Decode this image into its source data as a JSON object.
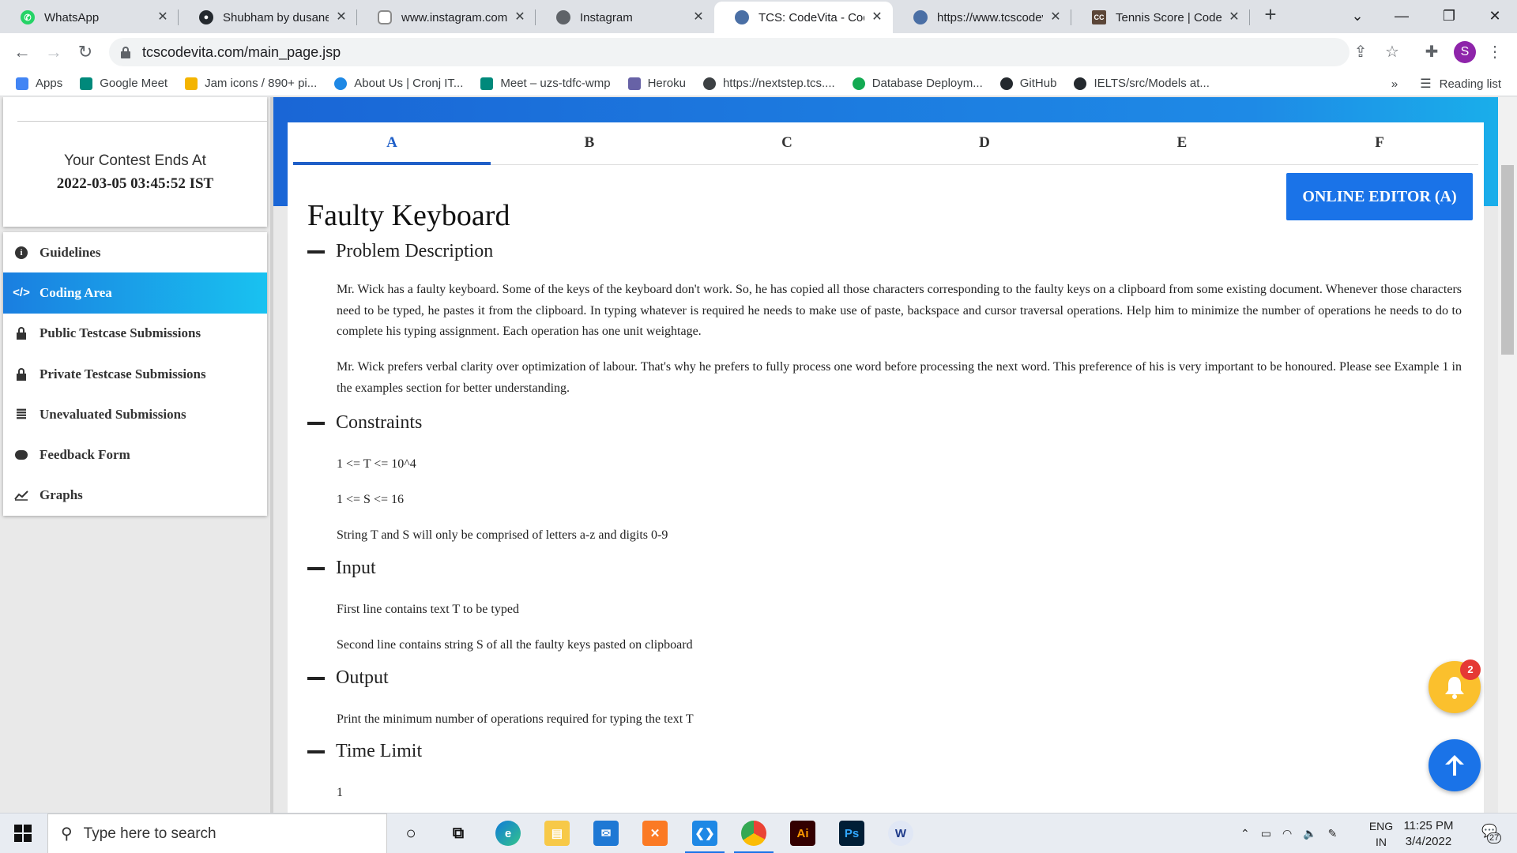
{
  "browser": {
    "tabs": [
      {
        "title": "WhatsApp",
        "icon": "whatsapp-icon",
        "color": "#25d366",
        "active": false
      },
      {
        "title": "Shubham by dusanes",
        "icon": "github-icon",
        "color": "#24292e",
        "active": false
      },
      {
        "title": "www.instagram.com",
        "icon": "instagram-icon",
        "color": "#8a8a8a",
        "active": false
      },
      {
        "title": "Instagram",
        "icon": "globe-icon",
        "color": "#5f6368",
        "active": false
      },
      {
        "title": "TCS: CodeVita - Codin",
        "icon": "tcs-icon",
        "color": "#4a6fa5",
        "active": true
      },
      {
        "title": "https://www.tcscodev",
        "icon": "tcs-icon",
        "color": "#4a6fa5",
        "active": false
      },
      {
        "title": "Tennis Score | CodeCh",
        "icon": "codechef-icon",
        "color": "#5b4638",
        "active": false
      }
    ],
    "url": "tcscodevita.com/main_page.jsp",
    "profile_initial": "S",
    "bookmarks": [
      {
        "label": "Apps",
        "color": "#4285f4"
      },
      {
        "label": "Google Meet",
        "color": "#00897b"
      },
      {
        "label": "Jam icons / 890+ pi...",
        "color": "#f4b400"
      },
      {
        "label": "About Us | Cronj IT...",
        "color": "#1e88e5"
      },
      {
        "label": "Meet – uzs-tdfc-wmp",
        "color": "#00897b"
      },
      {
        "label": "Heroku",
        "color": "#6762a6"
      },
      {
        "label": "https://nextstep.tcs....",
        "color": "#3c4043"
      },
      {
        "label": "Database Deploym...",
        "color": "#13aa52"
      },
      {
        "label": "GitHub",
        "color": "#24292e"
      },
      {
        "label": "IELTS/src/Models at...",
        "color": "#24292e"
      }
    ],
    "bookmarks_more": "»",
    "reading_list": "Reading list"
  },
  "contest": {
    "line1": "Your Contest Ends At",
    "line2": "2022-03-05 03:45:52 IST"
  },
  "menu": [
    {
      "label": "Guidelines",
      "icon": "info-icon",
      "glyph": "i",
      "active": false
    },
    {
      "label": "Coding Area",
      "icon": "code-icon",
      "glyph": "</>",
      "active": true
    },
    {
      "label": "Public Testcase Submissions",
      "icon": "lock-icon",
      "glyph": "",
      "active": false
    },
    {
      "label": "Private Testcase Submissions",
      "icon": "lock-icon",
      "glyph": "",
      "active": false
    },
    {
      "label": "Unevaluated Submissions",
      "icon": "list-icon",
      "glyph": "≣",
      "active": false
    },
    {
      "label": "Feedback Form",
      "icon": "comment-icon",
      "glyph": "💬",
      "active": false
    },
    {
      "label": "Graphs",
      "icon": "chart-icon",
      "glyph": "📈",
      "active": false
    }
  ],
  "problem_tabs": [
    "A",
    "B",
    "C",
    "D",
    "E",
    "F"
  ],
  "active_problem_tab": "A",
  "editor_button": "ONLINE EDITOR (A)",
  "problem": {
    "title": "Faulty Keyboard",
    "sections": {
      "description": "Problem Description",
      "constraints": "Constraints",
      "input": "Input",
      "output": "Output",
      "time_limit": "Time Limit"
    },
    "description_p1": "Mr. Wick has a faulty keyboard. Some of the keys of the keyboard don't work. So, he has copied all those characters corresponding to the faulty keys on a clipboard from some existing document. Whenever those characters need to be typed, he pastes it from the clipboard. In typing whatever is required he needs to make use of paste, backspace and cursor traversal operations. Help him to minimize the number of operations he needs to do to complete his typing assignment. Each operation has one unit weightage.",
    "description_p2": "Mr. Wick prefers verbal clarity over optimization of labour. That's why he prefers to fully process one word before processing the next word. This preference of his is very important to be honoured. Please see Example 1 in the examples section for better understanding.",
    "constraint1": "1 <= T <= 10^4",
    "constraint2": "1 <= S <= 16",
    "constraint3": "String T and S will only be comprised of letters a-z and digits 0-9",
    "input1": "First line contains text T to be typed",
    "input2": "Second line contains string S of all the faulty keys pasted on clipboard",
    "output1": "Print the minimum number of operations required for typing the text T",
    "time_limit": "1"
  },
  "notification_count": "2",
  "taskbar": {
    "search_placeholder": "Type here to search",
    "lang1": "ENG",
    "lang2": "IN",
    "time": "11:25 PM",
    "date": "3/4/2022",
    "notif_count": "27"
  }
}
